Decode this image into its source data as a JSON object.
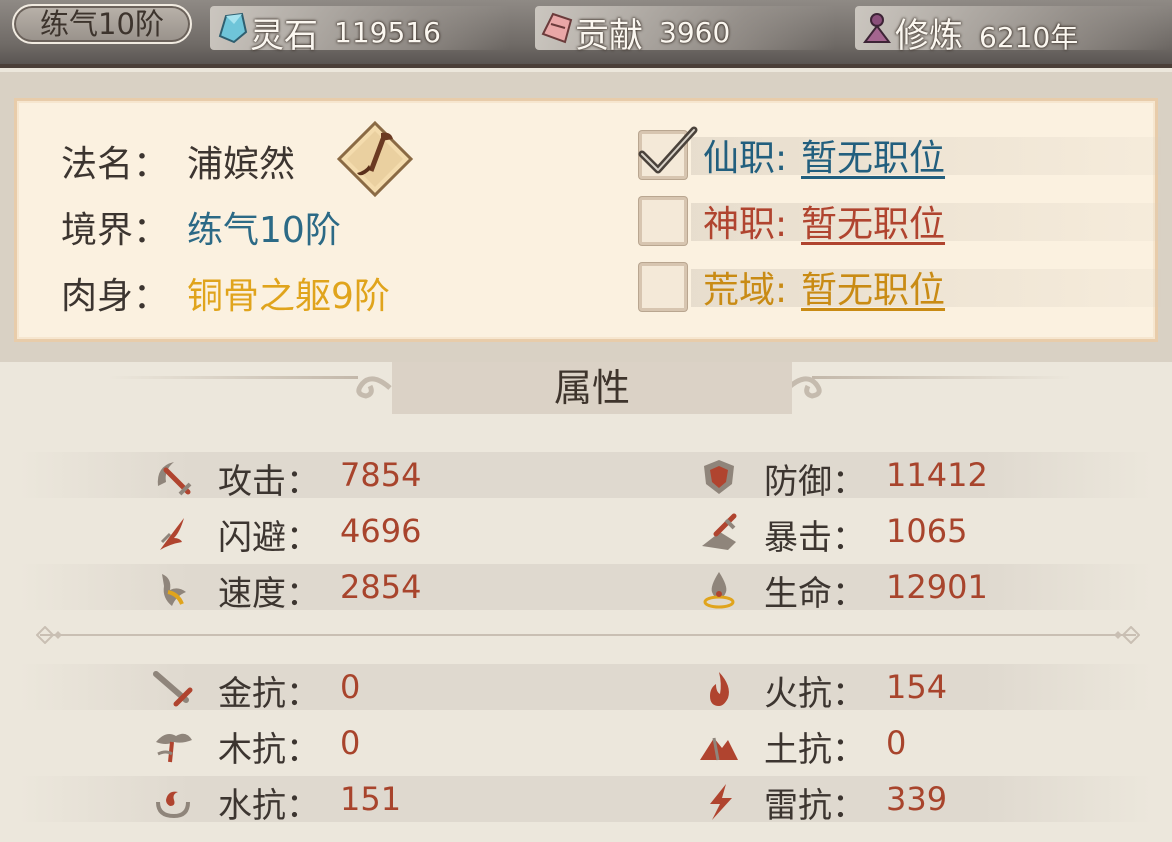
{
  "topbar": {
    "realm": "练气10阶",
    "resources": [
      {
        "label": "灵石",
        "value": "119516",
        "icon": "spirit-stone-icon"
      },
      {
        "label": "贡献",
        "value": "3960",
        "icon": "contribution-icon"
      },
      {
        "label": "修炼",
        "value": "6210年",
        "icon": "cultivation-icon"
      }
    ]
  },
  "info": {
    "name_key": "法名：",
    "name_val": "浦嫔然",
    "realm_key": "境界：",
    "realm_val": "练气10阶",
    "body_key": "肉身：",
    "body_val": "铜骨之躯9阶",
    "jobs": [
      {
        "label": "仙职:",
        "value": "暂无职位",
        "checked": true
      },
      {
        "label": "神职:",
        "value": "暂无职位",
        "checked": false
      },
      {
        "label": "荒域:",
        "value": "暂无职位",
        "checked": false
      }
    ]
  },
  "attributes": {
    "title": "属性",
    "stats": [
      {
        "label": "攻击：",
        "value": "7854",
        "icon": "attack-icon"
      },
      {
        "label": "防御：",
        "value": "11412",
        "icon": "defense-icon"
      },
      {
        "label": "闪避：",
        "value": "4696",
        "icon": "dodge-icon"
      },
      {
        "label": "暴击：",
        "value": "1065",
        "icon": "crit-icon"
      },
      {
        "label": "速度：",
        "value": "2854",
        "icon": "speed-icon"
      },
      {
        "label": "生命：",
        "value": "12901",
        "icon": "life-icon"
      }
    ],
    "resists": [
      {
        "label": "金抗：",
        "value": "0",
        "icon": "metal-icon"
      },
      {
        "label": "火抗：",
        "value": "154",
        "icon": "fire-icon"
      },
      {
        "label": "木抗：",
        "value": "0",
        "icon": "wood-icon"
      },
      {
        "label": "土抗：",
        "value": "0",
        "icon": "earth-icon"
      },
      {
        "label": "水抗：",
        "value": "151",
        "icon": "water-icon"
      },
      {
        "label": "雷抗：",
        "value": "339",
        "icon": "thunder-icon"
      }
    ]
  },
  "colors": {
    "realm": "#2c6a86",
    "body": "#e0a41c",
    "value": "#a8442c",
    "job_blue": "#225f7e",
    "job_red": "#b0442f",
    "job_gold": "#c98b14"
  }
}
